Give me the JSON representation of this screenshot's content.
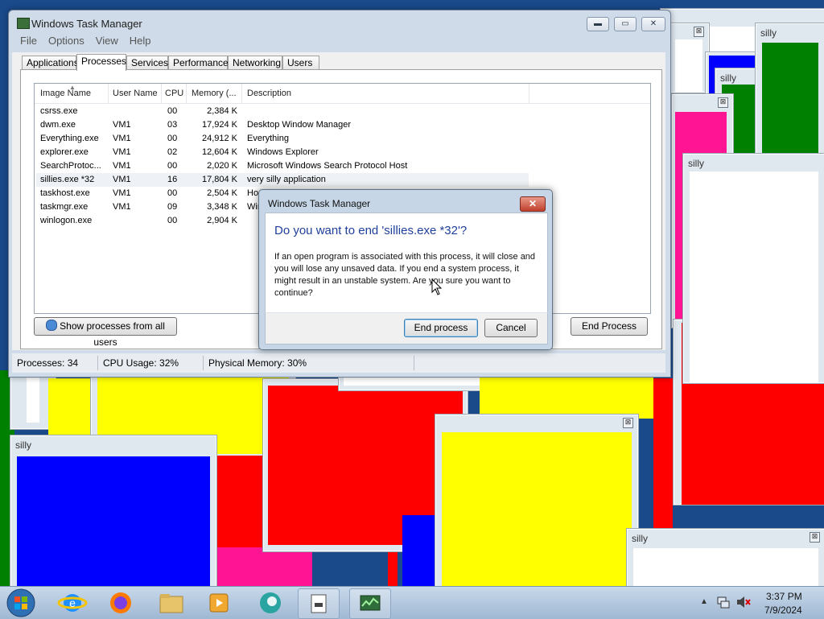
{
  "silly_title": "silly",
  "silly_close": "⊠",
  "taskmanager": {
    "title": "Windows Task Manager",
    "caption_buttons": {
      "minimize": "▬",
      "maximize": "▭",
      "close": "✕"
    },
    "menu": [
      "File",
      "Options",
      "View",
      "Help"
    ],
    "tabs": [
      "Applications",
      "Processes",
      "Services",
      "Performance",
      "Networking",
      "Users"
    ],
    "active_tab": "Processes",
    "columns": [
      "Image Name",
      "User Name",
      "CPU",
      "Memory (...",
      "Description"
    ],
    "processes": [
      {
        "image": "csrss.exe",
        "user": "",
        "cpu": "00",
        "memory": "2,384 K",
        "description": ""
      },
      {
        "image": "dwm.exe",
        "user": "VM1",
        "cpu": "03",
        "memory": "17,924 K",
        "description": "Desktop Window Manager"
      },
      {
        "image": "Everything.exe",
        "user": "VM1",
        "cpu": "00",
        "memory": "24,912 K",
        "description": "Everything"
      },
      {
        "image": "explorer.exe",
        "user": "VM1",
        "cpu": "02",
        "memory": "12,604 K",
        "description": "Windows Explorer"
      },
      {
        "image": "SearchProtoc...",
        "user": "VM1",
        "cpu": "00",
        "memory": "2,020 K",
        "description": "Microsoft Windows Search Protocol Host"
      },
      {
        "image": "sillies.exe *32",
        "user": "VM1",
        "cpu": "16",
        "memory": "17,804 K",
        "description": "very silly application"
      },
      {
        "image": "taskhost.exe",
        "user": "VM1",
        "cpu": "00",
        "memory": "2,504 K",
        "description": "Hos"
      },
      {
        "image": "taskmgr.exe",
        "user": "VM1",
        "cpu": "09",
        "memory": "3,348 K",
        "description": "Win"
      },
      {
        "image": "winlogon.exe",
        "user": "",
        "cpu": "00",
        "memory": "2,904 K",
        "description": ""
      }
    ],
    "show_all_button": "Show processes from all users",
    "end_process_button": "End Process",
    "status": {
      "processes": "Processes: 34",
      "cpu": "CPU Usage: 32%",
      "memory": "Physical Memory: 30%"
    }
  },
  "dialog": {
    "title": "Windows Task Manager",
    "close": "✕",
    "question": "Do you want to end 'sillies.exe *32'?",
    "message": "If an open program is associated with this process, it will close and you will lose any unsaved data. If you end a system process, it might result in an unstable system. Are you sure you want to continue?",
    "confirm": "End process",
    "cancel": "Cancel"
  },
  "taskbar": {
    "time": "3:37 PM",
    "date": "7/9/2024",
    "icons": [
      "start-orb-icon",
      "internet-explorer-icon",
      "firefox-icon",
      "file-explorer-icon",
      "media-player-icon",
      "app-icon",
      "sillies-app-icon",
      "task-manager-icon"
    ]
  },
  "colors": {
    "red": "#ff0000",
    "yellow": "#ffff00",
    "blue": "#0000ff",
    "green": "#008000",
    "magenta": "#ff1493",
    "white": "#ffffff"
  }
}
